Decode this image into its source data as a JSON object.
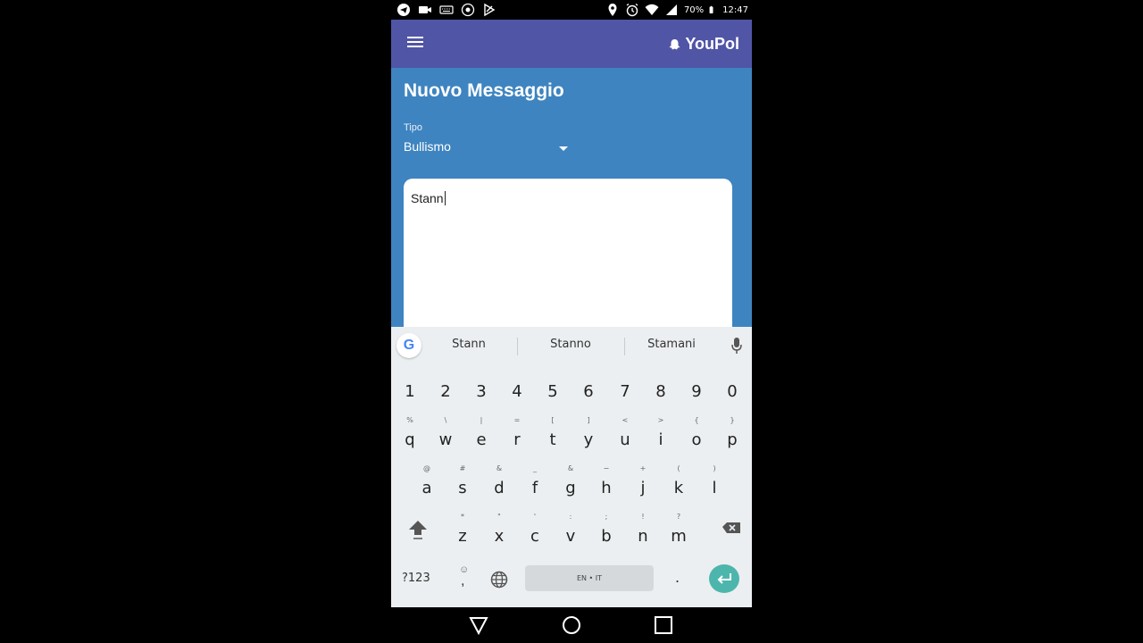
{
  "status_bar": {
    "battery_percent": "70%",
    "time": "12:47"
  },
  "app_bar": {
    "brand": "YouPol"
  },
  "form": {
    "title": "Nuovo Messaggio",
    "type_label": "Tipo",
    "type_value": "Bullismo",
    "message_text": "Stann"
  },
  "keyboard": {
    "suggestions": [
      "Stann",
      "Stanno",
      "Stamani"
    ],
    "number_row": [
      "1",
      "2",
      "3",
      "4",
      "5",
      "6",
      "7",
      "8",
      "9",
      "0"
    ],
    "row1": {
      "keys": [
        "q",
        "w",
        "e",
        "r",
        "t",
        "y",
        "u",
        "i",
        "o",
        "p"
      ],
      "hints": [
        "%",
        "\\",
        "|",
        "=",
        "[",
        "]",
        "<",
        ">",
        "{",
        "}"
      ]
    },
    "row2": {
      "keys": [
        "a",
        "s",
        "d",
        "f",
        "g",
        "h",
        "j",
        "k",
        "l"
      ],
      "hints": [
        "@",
        "#",
        "&",
        "_",
        "&",
        "−",
        "+",
        "(",
        ")"
      ]
    },
    "row3": {
      "keys": [
        "z",
        "x",
        "c",
        "v",
        "b",
        "n",
        "m"
      ],
      "hints": [
        "*",
        "\"",
        "'",
        ":",
        ";",
        "!",
        "?"
      ]
    },
    "symbols_label": "?123",
    "comma_hint": "☺",
    "comma": ",",
    "space_label": "EN • IT",
    "period": "."
  }
}
